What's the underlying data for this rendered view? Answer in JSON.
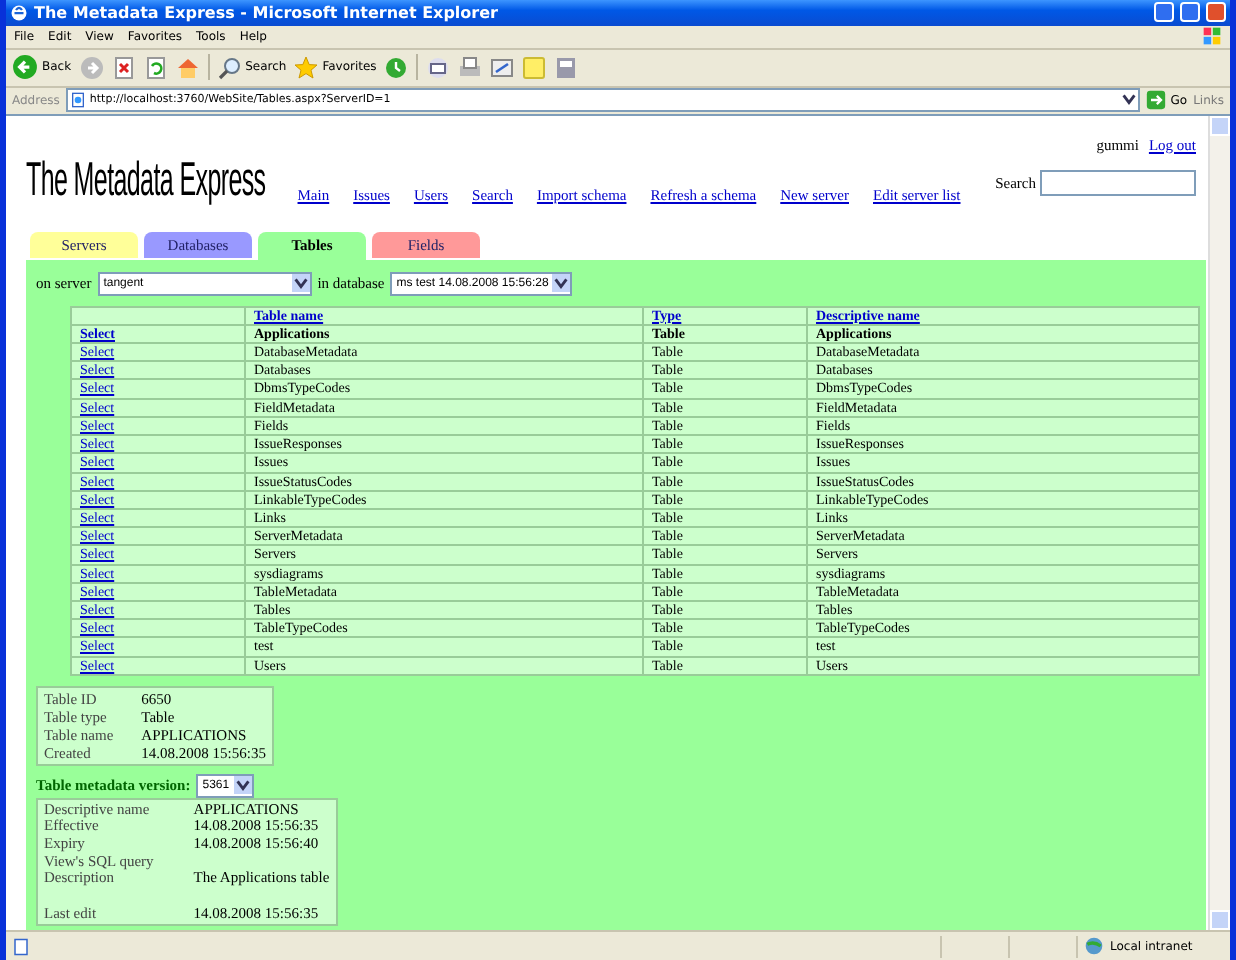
{
  "window": {
    "title": "The Metadata Express - Microsoft Internet Explorer"
  },
  "menu": [
    "File",
    "Edit",
    "View",
    "Favorites",
    "Tools",
    "Help"
  ],
  "toolbar": {
    "back": "Back",
    "search": "Search",
    "favorites": "Favorites"
  },
  "address_bar": {
    "label": "Address",
    "url": "http://localhost:3760/WebSite/Tables.aspx?ServerID=1",
    "go": "Go",
    "links": "Links"
  },
  "page": {
    "user": "gummi",
    "logout": "Log out",
    "logo": "The Metadata Express",
    "nav": [
      "Main",
      "Issues",
      "Users",
      "Search",
      "Import schema",
      "Refresh a schema",
      "New server",
      "Edit server list"
    ],
    "search_label": "Search",
    "tabs": [
      {
        "label": "Servers",
        "selected": false,
        "color": "#ffff99"
      },
      {
        "label": "Databases",
        "selected": false,
        "color": "#9999ff"
      },
      {
        "label": "Tables",
        "selected": true,
        "color": "#99ff99"
      },
      {
        "label": "Fields",
        "selected": false,
        "color": "#ff9999"
      }
    ],
    "server_label": "on server",
    "server": "tangent",
    "database_label": "in database",
    "database": "ms test 14.08.2008 15:56:28",
    "table": {
      "columns": [
        "Table name",
        "Type",
        "Descriptive name"
      ],
      "rows": [
        {
          "action": "Select",
          "name": "Applications",
          "type": "Table",
          "descriptive_name": "Applications",
          "selected": true
        },
        {
          "action": "Select",
          "name": "DatabaseMetadata",
          "type": "Table",
          "descriptive_name": "DatabaseMetadata",
          "selected": false
        },
        {
          "action": "Select",
          "name": "Databases",
          "type": "Table",
          "descriptive_name": "Databases",
          "selected": false
        },
        {
          "action": "Select",
          "name": "DbmsTypeCodes",
          "type": "Table",
          "descriptive_name": "DbmsTypeCodes",
          "selected": false
        },
        {
          "action": "Select",
          "name": "FieldMetadata",
          "type": "Table",
          "descriptive_name": "FieldMetadata",
          "selected": false
        },
        {
          "action": "Select",
          "name": "Fields",
          "type": "Table",
          "descriptive_name": "Fields",
          "selected": false
        },
        {
          "action": "Select",
          "name": "IssueResponses",
          "type": "Table",
          "descriptive_name": "IssueResponses",
          "selected": false
        },
        {
          "action": "Select",
          "name": "Issues",
          "type": "Table",
          "descriptive_name": "Issues",
          "selected": false
        },
        {
          "action": "Select",
          "name": "IssueStatusCodes",
          "type": "Table",
          "descriptive_name": "IssueStatusCodes",
          "selected": false
        },
        {
          "action": "Select",
          "name": "LinkableTypeCodes",
          "type": "Table",
          "descriptive_name": "LinkableTypeCodes",
          "selected": false
        },
        {
          "action": "Select",
          "name": "Links",
          "type": "Table",
          "descriptive_name": "Links",
          "selected": false
        },
        {
          "action": "Select",
          "name": "ServerMetadata",
          "type": "Table",
          "descriptive_name": "ServerMetadata",
          "selected": false
        },
        {
          "action": "Select",
          "name": "Servers",
          "type": "Table",
          "descriptive_name": "Servers",
          "selected": false
        },
        {
          "action": "Select",
          "name": "sysdiagrams",
          "type": "Table",
          "descriptive_name": "sysdiagrams",
          "selected": false
        },
        {
          "action": "Select",
          "name": "TableMetadata",
          "type": "Table",
          "descriptive_name": "TableMetadata",
          "selected": false
        },
        {
          "action": "Select",
          "name": "Tables",
          "type": "Table",
          "descriptive_name": "Tables",
          "selected": false
        },
        {
          "action": "Select",
          "name": "TableTypeCodes",
          "type": "Table",
          "descriptive_name": "TableTypeCodes",
          "selected": false
        },
        {
          "action": "Select",
          "name": "test",
          "type": "Table",
          "descriptive_name": "test",
          "selected": false
        },
        {
          "action": "Select",
          "name": "Users",
          "type": "Table",
          "descriptive_name": "Users",
          "selected": false
        }
      ]
    },
    "table_info": [
      {
        "label": "Table ID",
        "value": "6650"
      },
      {
        "label": "Table type",
        "value": "Table"
      },
      {
        "label": "Table name",
        "value": "APPLICATIONS"
      },
      {
        "label": "Created",
        "value": "14.08.2008 15:56:35"
      }
    ],
    "version_label": "Table metadata version:",
    "version": "5361",
    "metadata": [
      {
        "label": "Descriptive name",
        "value": "APPLICATIONS"
      },
      {
        "label": "Effective",
        "value": "14.08.2008 15:56:35"
      },
      {
        "label": "Expiry",
        "value": "14.08.2008 15:56:40"
      },
      {
        "label": "View's SQL query"
      },
      {
        "label": "Description",
        "value": "The Applications table"
      }
    ],
    "edit_history": [
      {
        "label": "Last edit",
        "value": "14.08.2008 15:56:35"
      }
    ]
  },
  "status_bar": {
    "zone": "Local intranet"
  }
}
